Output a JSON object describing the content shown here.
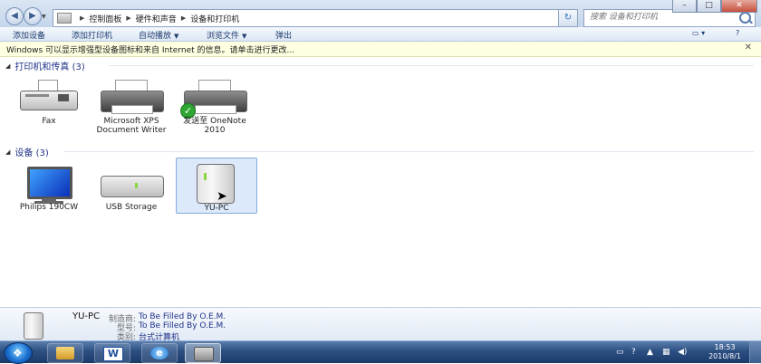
{
  "address": {
    "crumbs": [
      "控制面板",
      "硬件和声音",
      "设备和打印机"
    ],
    "search_placeholder": "搜索 设备和打印机"
  },
  "toolbar": {
    "add_device": "添加设备",
    "add_printer": "添加打印机",
    "autoplay": "自动播放",
    "browse_files": "浏览文件",
    "eject": "弹出"
  },
  "infobar": {
    "text": "Windows 可以显示增强型设备图标和来自 Internet 的信息。请单击进行更改..."
  },
  "groups": {
    "printers": {
      "title": "打印机和传真 (3)",
      "items": [
        {
          "label": "Fax"
        },
        {
          "label": "Microsoft XPS Document Writer"
        },
        {
          "label": "发送至 OneNote 2010"
        }
      ]
    },
    "devices": {
      "title": "设备 (3)",
      "items": [
        {
          "label": "Philips 190CW"
        },
        {
          "label": "USB Storage"
        },
        {
          "label": "YU-PC"
        }
      ]
    }
  },
  "details": {
    "name": "YU-PC",
    "rows": [
      {
        "key": "制造商:",
        "value": "To Be Filled By O.E.M."
      },
      {
        "key": "型号:",
        "value": "To Be Filled By O.E.M."
      },
      {
        "key": "类别:",
        "value": "台式计算机"
      }
    ]
  },
  "taskbar": {
    "time": "18:53",
    "date": "2010/8/1"
  },
  "colors": {
    "accent": "#1e3287",
    "selection": "#dbe9fa"
  }
}
